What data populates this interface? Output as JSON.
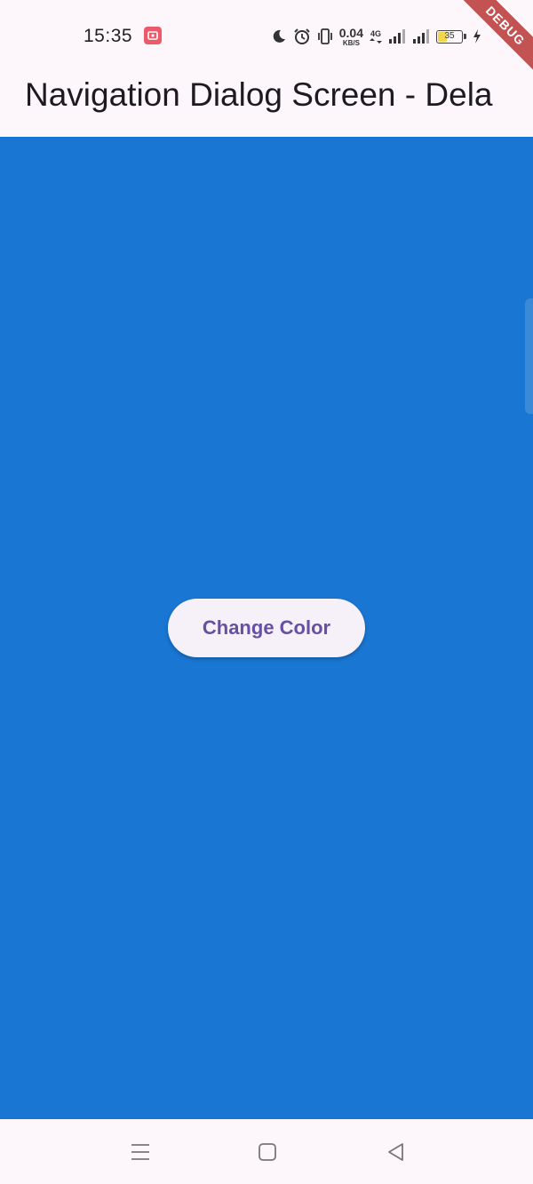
{
  "status_bar": {
    "time": "15:35",
    "net_speed_value": "0.04",
    "net_speed_unit": "KB/S",
    "network_type": "4G",
    "battery_level": "35",
    "icons": [
      "screen-record-icon",
      "moon-icon",
      "alarm-icon",
      "vibrate-icon",
      "data-arrows-icon",
      "signal-icon",
      "signal-icon",
      "battery-icon",
      "charging-icon"
    ]
  },
  "debug_banner": "DEBUG",
  "app_bar": {
    "title": "Navigation Dialog Screen - Dela"
  },
  "body": {
    "background_color": "#1976d2",
    "button_label": "Change Color"
  },
  "nav_bar": {
    "icons": [
      "menu-icon",
      "home-icon",
      "back-icon"
    ]
  }
}
